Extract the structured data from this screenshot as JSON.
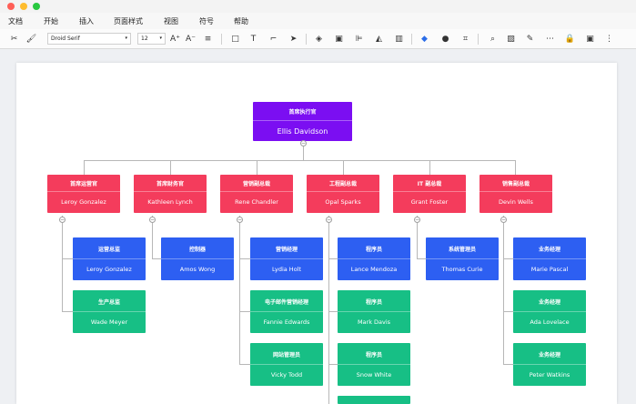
{
  "menubar": [
    "文档",
    "开始",
    "插入",
    "页面样式",
    "视图",
    "符号",
    "帮助"
  ],
  "toolbar": {
    "font_family": "Droid Serif",
    "font_size": "12"
  },
  "org": {
    "ceo": {
      "title": "首席执行官",
      "name": "Ellis Davidson"
    },
    "vps": [
      {
        "title": "首席运营官",
        "name": "Leroy Gonzalez"
      },
      {
        "title": "首席财务官",
        "name": "Kathleen Lynch"
      },
      {
        "title": "营销副总裁",
        "name": "Rene Chandler"
      },
      {
        "title": "工程副总裁",
        "name": "Opal Sparks"
      },
      {
        "title": "IT 副总裁",
        "name": "Grant Foster"
      },
      {
        "title": "销售副总裁",
        "name": "Devin Wells"
      }
    ],
    "staff": [
      [
        {
          "title": "运营总监",
          "name": "Leroy Gonzalez",
          "color": "blue"
        },
        {
          "title": "生产总监",
          "name": "Wade Meyer",
          "color": "green"
        }
      ],
      [
        {
          "title": "控制器",
          "name": "Amos Wong",
          "color": "blue"
        }
      ],
      [
        {
          "title": "营销经理",
          "name": "Lydia Holt",
          "color": "blue"
        },
        {
          "title": "电子邮件营销经理",
          "name": "Fannie Edwards",
          "color": "green"
        },
        {
          "title": "网站管理员",
          "name": "Vicky Todd",
          "color": "green"
        }
      ],
      [
        {
          "title": "程序员",
          "name": "Lance Mendoza",
          "color": "blue"
        },
        {
          "title": "程序员",
          "name": "Mark Davis",
          "color": "green"
        },
        {
          "title": "程序员",
          "name": "Snow White",
          "color": "green"
        }
      ],
      [
        {
          "title": "系统管理员",
          "name": "Thomas Curie",
          "color": "blue"
        }
      ],
      [
        {
          "title": "业务经理",
          "name": "Marie Pascal",
          "color": "blue"
        },
        {
          "title": "业务经理",
          "name": "Ada Lovelace",
          "color": "green"
        },
        {
          "title": "业务经理",
          "name": "Peter Watkins",
          "color": "green"
        }
      ]
    ]
  }
}
